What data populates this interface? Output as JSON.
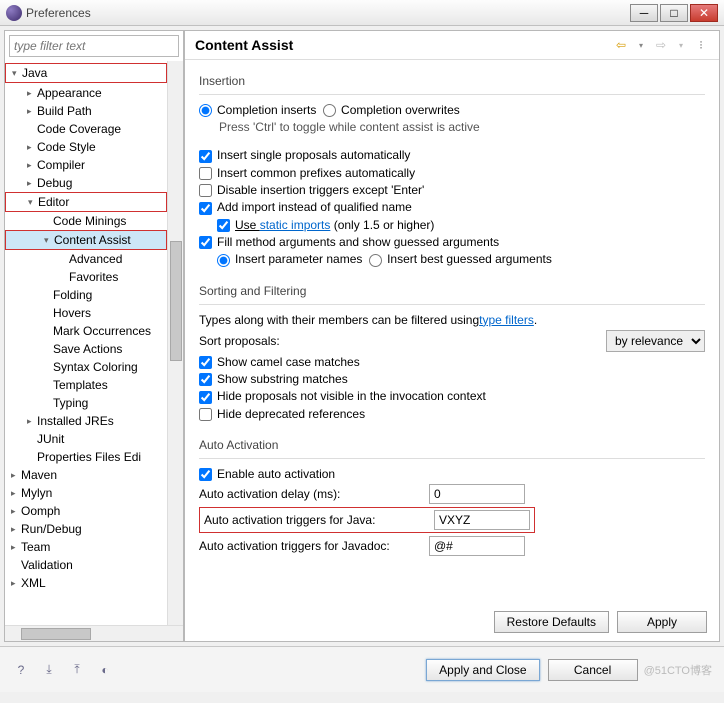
{
  "window": {
    "title": "Preferences"
  },
  "filter": {
    "placeholder": "type filter text"
  },
  "tree": {
    "java": "Java",
    "appearance": "Appearance",
    "buildpath": "Build Path",
    "codecoverage": "Code Coverage",
    "codestyle": "Code Style",
    "compiler": "Compiler",
    "debug": "Debug",
    "editor": "Editor",
    "codeminings": "Code Minings",
    "contentassist": "Content Assist",
    "advanced": "Advanced",
    "favorites": "Favorites",
    "folding": "Folding",
    "hovers": "Hovers",
    "markoccurrences": "Mark Occurrences",
    "saveactions": "Save Actions",
    "syntaxcoloring": "Syntax Coloring",
    "templates": "Templates",
    "typing": "Typing",
    "installedjres": "Installed JREs",
    "junit": "JUnit",
    "propertiesfiles": "Properties Files Edi",
    "maven": "Maven",
    "mylyn": "Mylyn",
    "oomph": "Oomph",
    "rundebug": "Run/Debug",
    "team": "Team",
    "validation": "Validation",
    "xml": "XML"
  },
  "page": {
    "title": "Content Assist",
    "insertion": {
      "title": "Insertion",
      "completion_inserts": "Completion inserts",
      "completion_overwrites": "Completion overwrites",
      "ctrl_hint": "Press 'Ctrl' to toggle while content assist is active",
      "single_proposals": "Insert single proposals automatically",
      "common_prefixes": "Insert common prefixes automatically",
      "disable_triggers": "Disable insertion triggers except 'Enter'",
      "add_import": "Add import instead of qualified name",
      "use_static_pre": "Use ",
      "use_static_link": "static imports",
      "use_static_post": " (only 1.5 or higher)",
      "fill_method": "Fill method arguments and show guessed arguments",
      "insert_param": "Insert parameter names",
      "insert_best": "Insert best guessed arguments"
    },
    "sorting": {
      "title": "Sorting and Filtering",
      "type_filters_pre": "Types along with their members can be filtered using ",
      "type_filters_link": "type filters",
      "sort_label": "Sort proposals:",
      "sort_value": "by relevance",
      "camel": "Show camel case matches",
      "substring": "Show substring matches",
      "hide_not_visible": "Hide proposals not visible in the invocation context",
      "hide_deprecated": "Hide deprecated references"
    },
    "auto": {
      "title": "Auto Activation",
      "enable": "Enable auto activation",
      "delay_label": "Auto activation delay (ms):",
      "delay_value": "0",
      "java_label": "Auto activation triggers for Java:",
      "java_value": "VXYZ",
      "javadoc_label": "Auto activation triggers for Javadoc:",
      "javadoc_value": "@#"
    }
  },
  "buttons": {
    "restore": "Restore Defaults",
    "apply": "Apply",
    "applyclose": "Apply and Close",
    "cancel": "Cancel"
  },
  "watermark": "@51CTO博客"
}
